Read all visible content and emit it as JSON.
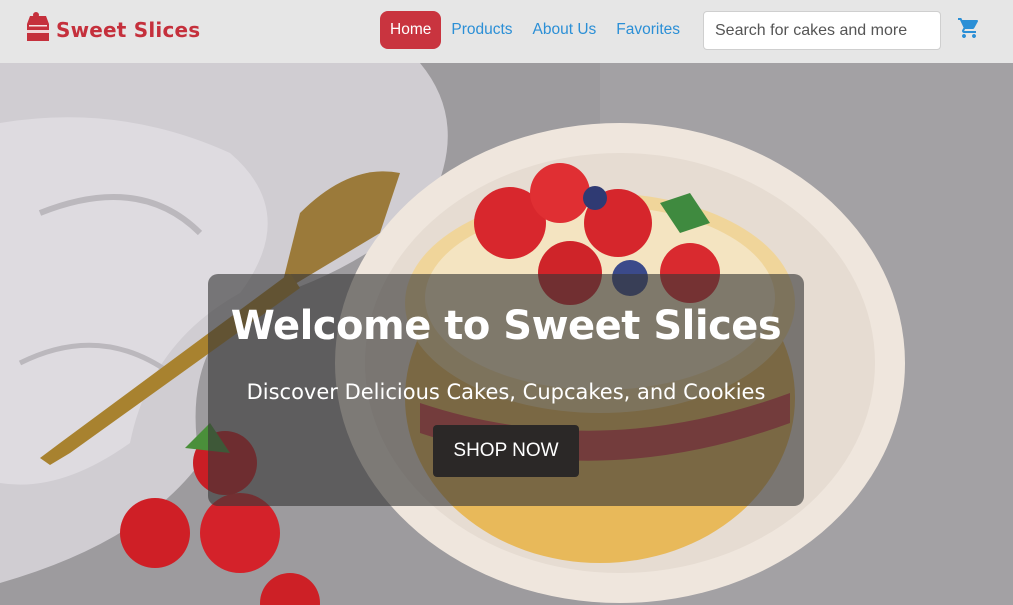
{
  "brand": {
    "name": "Sweet Slices",
    "logo_icon": "cake-slice-icon"
  },
  "nav": {
    "items": [
      {
        "label": "Home",
        "active": true
      },
      {
        "label": "Products",
        "active": false
      },
      {
        "label": "About Us",
        "active": false
      },
      {
        "label": "Favorites",
        "active": false
      }
    ]
  },
  "search": {
    "placeholder": "Search for cakes and more",
    "value": ""
  },
  "cart": {
    "icon": "shopping-cart-icon"
  },
  "hero": {
    "title": "Welcome to Sweet Slices",
    "subtitle": "Discover Delicious Cakes, Cupcakes, and Cookies",
    "cta": "SHOP NOW"
  },
  "colors": {
    "brand": "#c5303c",
    "link": "#2b8fd6",
    "nav_bg": "#e6e6e6",
    "cta_bg": "#2b2827"
  }
}
